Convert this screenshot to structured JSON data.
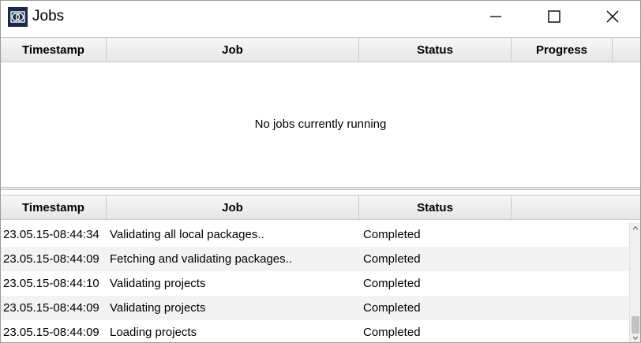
{
  "window": {
    "title": "Jobs"
  },
  "icons": {
    "app": "app-logo-icon",
    "minimize": "minimize-icon",
    "maximize": "maximize-icon",
    "close": "close-icon"
  },
  "running_table": {
    "headers": {
      "timestamp": "Timestamp",
      "job": "Job",
      "status": "Status",
      "progress": "Progress"
    },
    "empty_message": "No jobs currently running"
  },
  "history_table": {
    "headers": {
      "timestamp": "Timestamp",
      "job": "Job",
      "status": "Status"
    },
    "rows": [
      {
        "timestamp": "23.05.15-08:44:34",
        "job": "Validating all local packages..",
        "status": "Completed"
      },
      {
        "timestamp": "23.05.15-08:44:09",
        "job": "Fetching and validating packages..",
        "status": "Completed"
      },
      {
        "timestamp": "23.05.15-08:44:10",
        "job": "Validating projects",
        "status": "Completed"
      },
      {
        "timestamp": "23.05.15-08:44:09",
        "job": "Validating projects",
        "status": "Completed"
      },
      {
        "timestamp": "23.05.15-08:44:09",
        "job": "Loading projects",
        "status": "Completed"
      }
    ]
  },
  "colors": {
    "app_icon_bg": "#172a4b",
    "alt_row": "#f3f3f3"
  }
}
